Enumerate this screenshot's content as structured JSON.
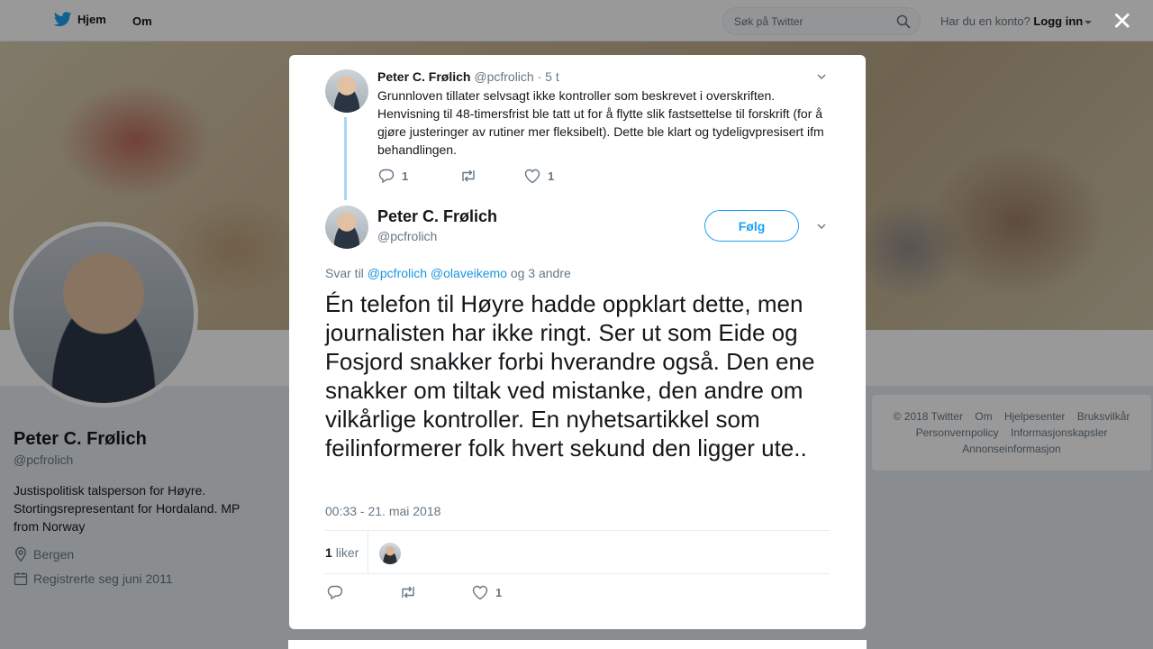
{
  "nav": {
    "home_label": "Hjem",
    "about_label": "Om",
    "search_placeholder": "Søk på Twitter",
    "account_prompt": "Har du en konto?",
    "login_label": "Logg inn"
  },
  "profile": {
    "name": "Peter C. Frølich",
    "handle": "@pcfrolich",
    "bio": "Justispolitisk talsperson for Høyre. Stortingsrepresentant for Hordaland. MP from Norway",
    "location": "Bergen",
    "joined": "Registrerte seg juni 2011"
  },
  "footer": {
    "links": [
      "© 2018 Twitter",
      "Om",
      "Hjelpesenter",
      "Bruksvilkår",
      "Personvernpolicy",
      "Informasjonskapsler",
      "Annonseinformasjon"
    ]
  },
  "parent_tweet": {
    "name": "Peter C. Frølich",
    "handle": "@pcfrolich",
    "time": "· 5 t",
    "text": "Grunnloven tillater selvsagt ikke kontroller som beskrevet i overskriften. Henvisning til 48-timersfrist ble tatt ut for å flytte slik fastsettelse til forskrift (for å gjøre justeringer av rutiner mer fleksibelt). Dette ble klart og tydeligvpresisert ifm behandlingen.",
    "replies": "1",
    "retweets": "",
    "likes": "1"
  },
  "main_tweet": {
    "name": "Peter C. Frølich",
    "handle": "@pcfrolich",
    "follow_label": "Følg",
    "reply_prefix": "Svar til",
    "reply_mention_1": "@pcfrolich",
    "reply_mention_2": "@olaveikemo",
    "reply_suffix": "og 3 andre",
    "text": "Én telefon til Høyre hadde oppklart dette, men journalisten har ikke ringt. Ser ut som Eide og Fosjord snakker forbi hverandre også. Den ene snakker om tiltak ved mistanke, den andre om vilkårlige kontroller. En nyhetsartikkel som feilinformerer folk hvert sekund den ligger ute..",
    "timestamp": "00:33 - 21. mai 2018",
    "likes_count": "1",
    "likes_label": "liker",
    "replies": "",
    "retweets": "",
    "likes": "1"
  },
  "colors": {
    "accent": "#1da1f2",
    "link": "#1b95e0",
    "thread_line": "#a8d8f5",
    "muted": "#657786"
  }
}
